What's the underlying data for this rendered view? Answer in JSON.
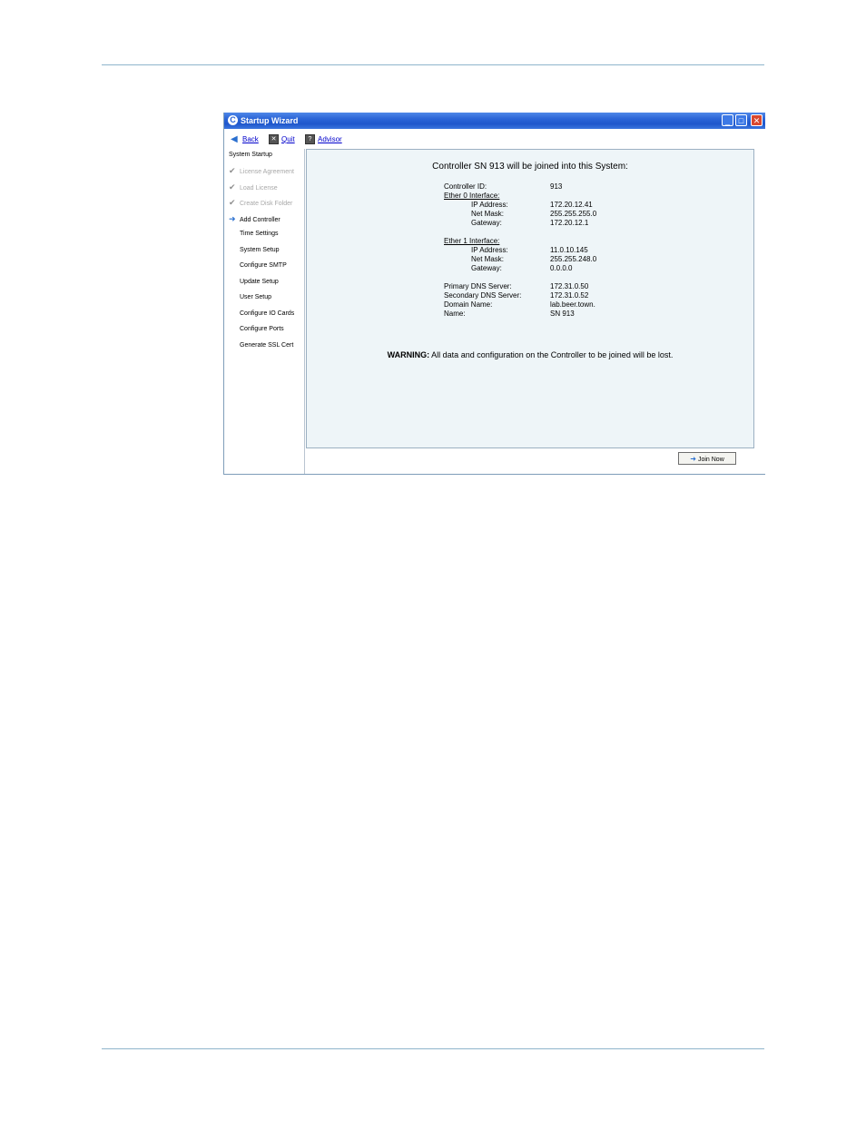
{
  "window": {
    "title": "Startup Wizard"
  },
  "toolbar": {
    "back_label": "Back",
    "quit_label": "Quit",
    "advisor_label": "Advisor"
  },
  "sidebar": {
    "header": "System Startup",
    "steps": [
      {
        "label": "License Agreement",
        "state": "done"
      },
      {
        "label": "Load License",
        "state": "done"
      },
      {
        "label": "Create Disk Folder",
        "state": "done"
      },
      {
        "label": "Add Controller",
        "state": "current"
      },
      {
        "label": "Time Settings",
        "state": "pending"
      },
      {
        "label": "System Setup",
        "state": "pending"
      },
      {
        "label": "Configure SMTP",
        "state": "pending"
      },
      {
        "label": "Update Setup",
        "state": "pending"
      },
      {
        "label": "User Setup",
        "state": "pending"
      },
      {
        "label": "Configure IO Cards",
        "state": "pending"
      },
      {
        "label": "Configure Ports",
        "state": "pending"
      },
      {
        "label": "Generate SSL Cert",
        "state": "pending"
      }
    ]
  },
  "main": {
    "heading": "Controller SN 913 will be joined into this System:",
    "controller_id": {
      "label": "Controller ID:",
      "value": "913"
    },
    "ether0": {
      "title": "Ether 0 Interface:",
      "ip": {
        "label": "IP Address:",
        "value": "172.20.12.41"
      },
      "mask": {
        "label": "Net Mask:",
        "value": "255.255.255.0"
      },
      "gateway": {
        "label": "Gateway:",
        "value": "172.20.12.1"
      }
    },
    "ether1": {
      "title": "Ether 1 Interface:",
      "ip": {
        "label": "IP Address:",
        "value": "11.0.10.145"
      },
      "mask": {
        "label": "Net Mask:",
        "value": "255.255.248.0"
      },
      "gateway": {
        "label": "Gateway:",
        "value": "0.0.0.0"
      }
    },
    "primary_dns": {
      "label": "Primary DNS Server:",
      "value": "172.31.0.50"
    },
    "secondary_dns": {
      "label": "Secondary DNS Server:",
      "value": "172.31.0.52"
    },
    "domain": {
      "label": "Domain Name:",
      "value": "lab.beer.town."
    },
    "name": {
      "label": "Name:",
      "value": "SN 913"
    },
    "warning_label": "WARNING:",
    "warning_text": "All data and configuration on the Controller to be joined will be lost."
  },
  "footer": {
    "join_label": "Join Now"
  }
}
